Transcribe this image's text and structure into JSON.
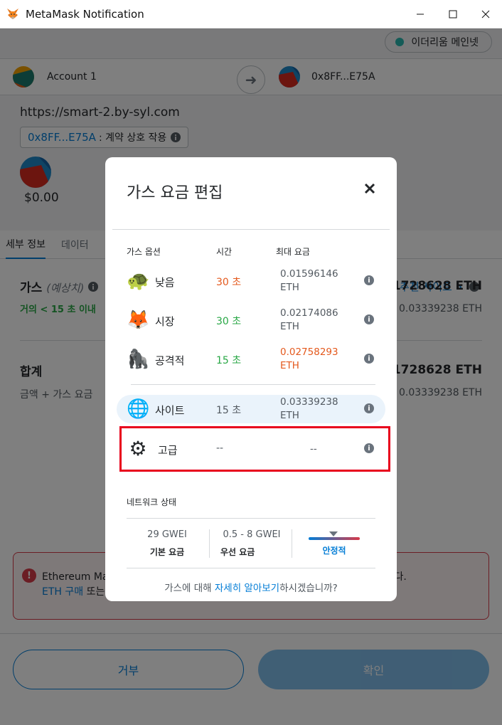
{
  "window": {
    "title": "MetaMask Notification",
    "minimize": "—",
    "maximize": "☐",
    "close": "✕"
  },
  "network": {
    "label": "이더리움 메인넷",
    "dot_color": "#29b6af"
  },
  "accounts": {
    "from": "Account 1",
    "to": "0x8FF...E75A"
  },
  "origin": {
    "url": "https://smart-2.by-syl.com",
    "contract_addr": "0x8FF...E75A",
    "contract_action": ": 계약 상호 작용",
    "amount": "$0.00"
  },
  "tabs": [
    {
      "label": "세부 정보"
    },
    {
      "label": "데이터"
    }
  ],
  "details": {
    "suggested_link": "추천 사이트",
    "gas_label": "가스",
    "gas_estimate": "(예상치)",
    "gas_speed": "거의 < 15 초 이내",
    "gas_amount": "0.01728628 ETH",
    "gas_max": "0.03339238 ETH",
    "total_label": "합계",
    "total_sub": "금액 + 가스 요금",
    "total_amount": "0.01728628 ETH",
    "total_max": "0.03339238 ETH"
  },
  "error": {
    "line1": "Ethereum Mainnet 네트워크의 거래 수수료를 지불할 계정에 ETH(이)가 부족합니다.",
    "link": "ETH 구매",
    "line2": " 또는 다른 계정에서 입금하세요."
  },
  "footer": {
    "reject": "거부",
    "confirm": "확인"
  },
  "modal": {
    "title": "가스 요금 편집",
    "col_option": "가스 옵션",
    "col_time": "시간",
    "col_max_fee": "최대 요금",
    "options": [
      {
        "icon": "🐢",
        "name": "낮음",
        "time": "30 초",
        "fee1": "0.01596146",
        "fee2": "ETH"
      },
      {
        "icon": "🦊",
        "name": "시장",
        "time": "30 초",
        "fee1": "0.02174086",
        "fee2": "ETH"
      },
      {
        "icon": "🦍",
        "name": "공격적",
        "time": "15 초",
        "fee1": "0.02758293",
        "fee2": "ETH"
      },
      {
        "icon": "🌐",
        "name": "사이트",
        "time": "15 초",
        "fee1": "0.03339238",
        "fee2": "ETH"
      },
      {
        "icon": "⚙",
        "name": "고급",
        "time": "--",
        "fee1": "--",
        "fee2": ""
      }
    ],
    "network_status": {
      "title": "네트워크 상태",
      "base_value": "29 GWEI",
      "base_label": "기본 요금",
      "priority_value": "0.5 - 8 GWEI",
      "priority_label": "우선 요금",
      "stability_label": "안정적"
    },
    "learn_pre": "가스에 대해 ",
    "learn_link": "자세히 알아보기",
    "learn_post": "하시겠습니까?"
  },
  "colors": {
    "accent": "#037dd6",
    "error": "#d73a49",
    "highlight_box": "#e8001c",
    "success": "#28a745",
    "warning": "#e4591d"
  }
}
